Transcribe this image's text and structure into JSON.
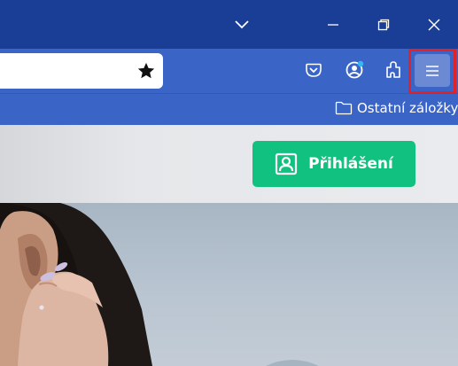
{
  "window_controls": {
    "list_all_tabs": "chevron-down-icon",
    "minimize": "minimize-icon",
    "restore": "restore-icon",
    "close": "close-icon"
  },
  "address_bar": {
    "value": "",
    "bookmark_icon": "star-filled-icon"
  },
  "toolbar": {
    "icons": [
      "pocket-icon",
      "account-icon",
      "extensions-icon",
      "hamburger-menu-icon"
    ]
  },
  "bookmarks_bar": {
    "other_bookmarks_label": "Ostatní záložky"
  },
  "page": {
    "login_label": "Přihlášení"
  },
  "colors": {
    "titlebar": "#1a3d96",
    "toolbar": "#3a64c6",
    "highlight": "#e0232a",
    "login_button": "#11c17f"
  }
}
